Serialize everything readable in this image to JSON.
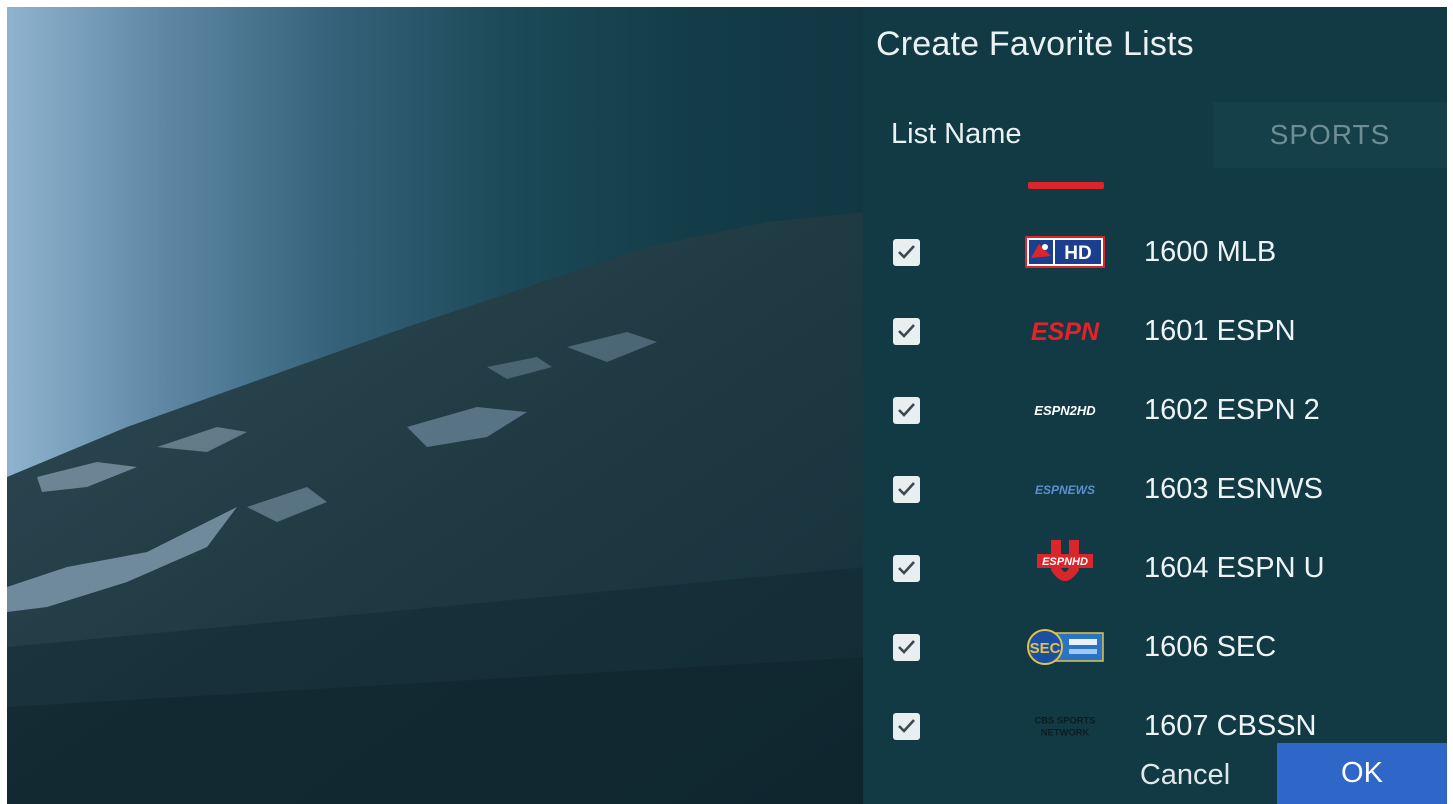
{
  "panel": {
    "title": "Create Favorite Lists",
    "list_name_label": "List Name",
    "list_name_value": "SPORTS"
  },
  "channels": [
    {
      "label": "1600 MLB",
      "checked": true,
      "logo": "mlb-hd-logo",
      "logo_text": "HD"
    },
    {
      "label": "1601 ESPN",
      "checked": true,
      "logo": "espn-logo",
      "logo_text": "ESPN"
    },
    {
      "label": "1602 ESPN 2",
      "checked": true,
      "logo": "espn2hd-logo",
      "logo_text": "ESPN2HD"
    },
    {
      "label": "1603 ESNWS",
      "checked": true,
      "logo": "espnews-logo",
      "logo_text": "ESPNEWS"
    },
    {
      "label": "1604 ESPN U",
      "checked": true,
      "logo": "espnu-logo",
      "logo_text": "ESPNHD"
    },
    {
      "label": "1606 SEC",
      "checked": true,
      "logo": "sec-network-logo",
      "logo_text": "SEC"
    },
    {
      "label": "1607 CBSSN",
      "checked": true,
      "logo": "cbs-sports-network-logo",
      "logo_text": "CBS SPORTS NETWORK"
    }
  ],
  "buttons": {
    "cancel": "Cancel",
    "ok": "OK"
  },
  "colors": {
    "panel_bg": "#123a44",
    "ok_button": "#2f67c8",
    "espn_red": "#d8262c"
  }
}
